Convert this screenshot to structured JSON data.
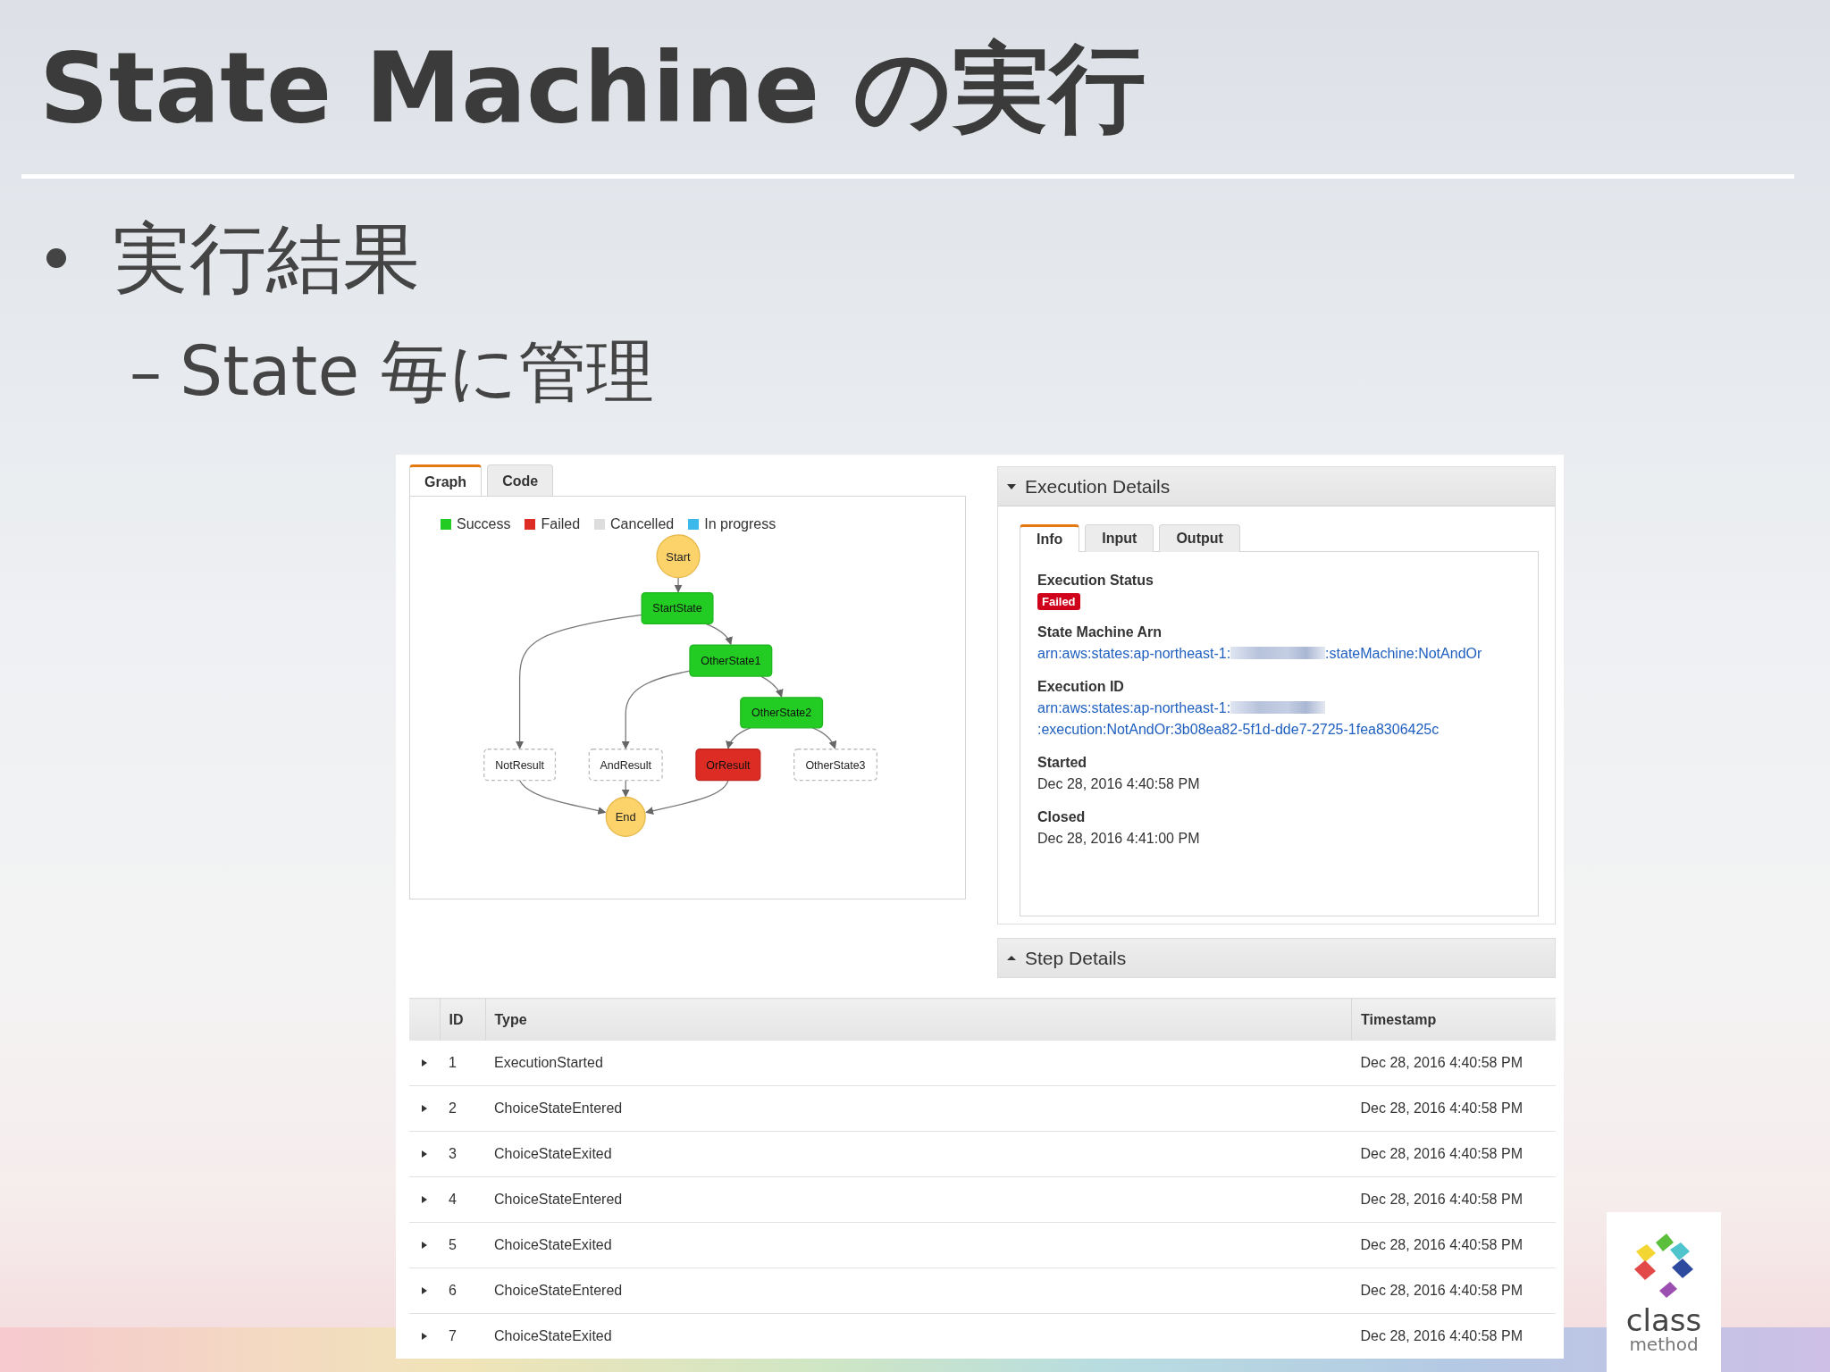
{
  "slide": {
    "title": "State Machine の実行",
    "bullets": [
      {
        "text": "実行結果",
        "sub": [
          {
            "marker": "–",
            "text": "State 毎に管理"
          }
        ]
      }
    ]
  },
  "graph_panel": {
    "tabs": [
      {
        "label": "Graph",
        "selected": true
      },
      {
        "label": "Code",
        "selected": false
      }
    ],
    "legend": [
      {
        "label": "Success",
        "color": "#22cc22"
      },
      {
        "label": "Failed",
        "color": "#dd2c24"
      },
      {
        "label": "Cancelled",
        "color": "#dddddd"
      },
      {
        "label": "In progress",
        "color": "#3bb9ea"
      }
    ],
    "nodes": [
      {
        "label": "Start",
        "kind": "terminal"
      },
      {
        "label": "StartState",
        "kind": "succeeded"
      },
      {
        "label": "OtherState1",
        "kind": "succeeded"
      },
      {
        "label": "OtherState2",
        "kind": "succeeded"
      },
      {
        "label": "NotResult",
        "kind": "skipped"
      },
      {
        "label": "AndResult",
        "kind": "skipped"
      },
      {
        "label": "OrResult",
        "kind": "failed"
      },
      {
        "label": "OtherState3",
        "kind": "skipped"
      },
      {
        "label": "End",
        "kind": "terminal"
      }
    ]
  },
  "execution_details": {
    "title": "Execution Details",
    "expanded": true,
    "tabs": [
      {
        "label": "Info",
        "selected": true
      },
      {
        "label": "Input",
        "selected": false
      },
      {
        "label": "Output",
        "selected": false
      }
    ],
    "fields": [
      {
        "label": "Execution Status",
        "kind": "badge",
        "parts": [
          "Failed"
        ]
      },
      {
        "label": "State Machine Arn",
        "kind": "link",
        "parts": [
          "arn:aws:states:ap-northeast-1:",
          ":stateMachine:NotAndOr"
        ]
      },
      {
        "label": "Execution ID",
        "kind": "link",
        "parts": [
          "arn:aws:states:ap-northeast-1:",
          ":execution:NotAndOr:3b08ea82-5f1d-dde7-2725-1fea8306425c"
        ]
      },
      {
        "label": "Started",
        "kind": "text",
        "parts": [
          "Dec 28, 2016 4:40:58 PM"
        ]
      },
      {
        "label": "Closed",
        "kind": "text",
        "parts": [
          "Dec 28, 2016 4:41:00 PM"
        ]
      }
    ]
  },
  "step_details": {
    "title": "Step Details",
    "expanded": false
  },
  "table": {
    "columns": [
      "ID",
      "Type",
      "Timestamp"
    ],
    "rows": [
      {
        "expanded": false,
        "cells": [
          "1",
          "ExecutionStarted",
          "Dec 28, 2016 4:40:58 PM"
        ]
      },
      {
        "expanded": false,
        "cells": [
          "2",
          "ChoiceStateEntered",
          "Dec 28, 2016 4:40:58 PM"
        ]
      },
      {
        "expanded": false,
        "cells": [
          "3",
          "ChoiceStateExited",
          "Dec 28, 2016 4:40:58 PM"
        ]
      },
      {
        "expanded": false,
        "cells": [
          "4",
          "ChoiceStateEntered",
          "Dec 28, 2016 4:40:58 PM"
        ]
      },
      {
        "expanded": false,
        "cells": [
          "5",
          "ChoiceStateExited",
          "Dec 28, 2016 4:40:58 PM"
        ]
      },
      {
        "expanded": false,
        "cells": [
          "6",
          "ChoiceStateEntered",
          "Dec 28, 2016 4:40:58 PM"
        ]
      },
      {
        "expanded": false,
        "cells": [
          "7",
          "ChoiceStateExited",
          "Dec 28, 2016 4:40:58 PM"
        ]
      }
    ]
  },
  "logo": {
    "lines": [
      "class",
      "method"
    ]
  }
}
